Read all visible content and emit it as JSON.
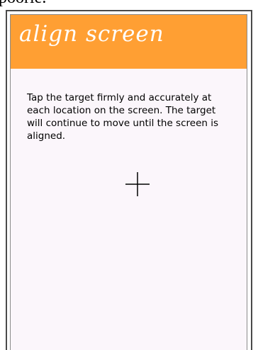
{
  "page": {
    "top_fragment": "poorie."
  },
  "header": {
    "title": "align screen"
  },
  "content": {
    "instructions": "Tap the target firmly and accurately at each location on the screen. The target will continue to move until the screen is aligned."
  },
  "target": {
    "icon": "crosshair-icon"
  },
  "colors": {
    "header_background": "#ff9f33",
    "screen_background": "#fbf6fb",
    "title_text": "#ffffff"
  }
}
